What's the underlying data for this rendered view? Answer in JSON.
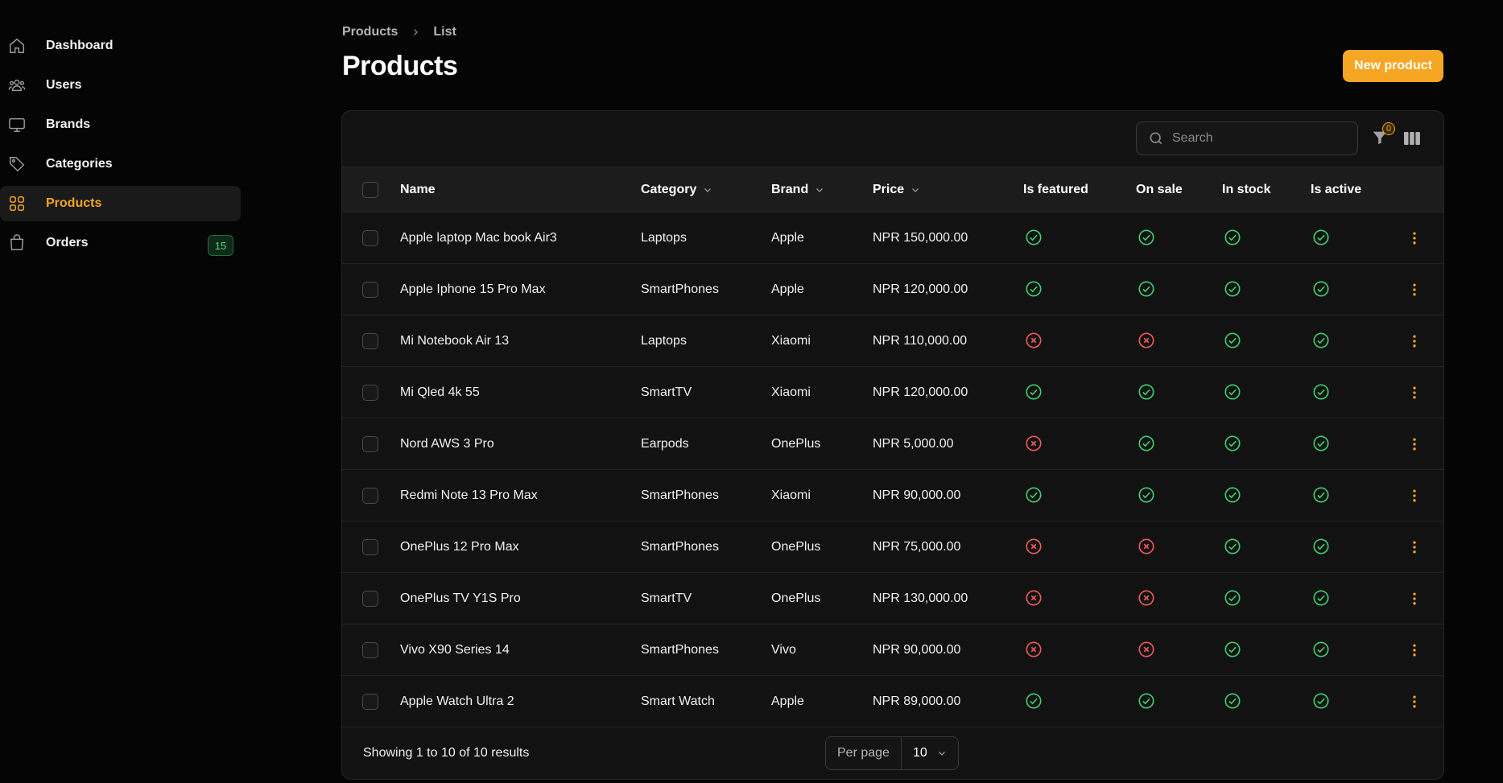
{
  "sidebar": {
    "items": [
      {
        "label": "Dashboard",
        "icon": "home-icon"
      },
      {
        "label": "Users",
        "icon": "users-icon"
      },
      {
        "label": "Brands",
        "icon": "monitor-icon"
      },
      {
        "label": "Categories",
        "icon": "tag-icon"
      },
      {
        "label": "Products",
        "icon": "grid-icon",
        "active": true
      },
      {
        "label": "Orders",
        "icon": "shopping-bag-icon",
        "badge": "15"
      }
    ]
  },
  "breadcrumb": {
    "parent": "Products",
    "current": "List"
  },
  "page": {
    "title": "Products",
    "new_button": "New product"
  },
  "toolbar": {
    "search_placeholder": "Search",
    "filter_count": "0"
  },
  "table": {
    "headers": {
      "name": "Name",
      "category": "Category",
      "brand": "Brand",
      "price": "Price",
      "is_featured": "Is featured",
      "on_sale": "On sale",
      "in_stock": "In stock",
      "is_active": "Is active"
    },
    "rows": [
      {
        "name": "Apple laptop Mac book Air3",
        "category": "Laptops",
        "brand": "Apple",
        "price": "NPR 150,000.00",
        "is_featured": true,
        "on_sale": true,
        "in_stock": true,
        "is_active": true
      },
      {
        "name": "Apple Iphone 15 Pro Max",
        "category": "SmartPhones",
        "brand": "Apple",
        "price": "NPR 120,000.00",
        "is_featured": true,
        "on_sale": true,
        "in_stock": true,
        "is_active": true
      },
      {
        "name": "Mi Notebook Air 13",
        "category": "Laptops",
        "brand": "Xiaomi",
        "price": "NPR 110,000.00",
        "is_featured": false,
        "on_sale": false,
        "in_stock": true,
        "is_active": true
      },
      {
        "name": "Mi Qled 4k 55",
        "category": "SmartTV",
        "brand": "Xiaomi",
        "price": "NPR 120,000.00",
        "is_featured": true,
        "on_sale": true,
        "in_stock": true,
        "is_active": true
      },
      {
        "name": "Nord AWS 3 Pro",
        "category": "Earpods",
        "brand": "OnePlus",
        "price": "NPR 5,000.00",
        "is_featured": false,
        "on_sale": true,
        "in_stock": true,
        "is_active": true
      },
      {
        "name": "Redmi Note 13 Pro Max",
        "category": "SmartPhones",
        "brand": "Xiaomi",
        "price": "NPR 90,000.00",
        "is_featured": true,
        "on_sale": true,
        "in_stock": true,
        "is_active": true
      },
      {
        "name": "OnePlus 12 Pro Max",
        "category": "SmartPhones",
        "brand": "OnePlus",
        "price": "NPR 75,000.00",
        "is_featured": false,
        "on_sale": false,
        "in_stock": true,
        "is_active": true
      },
      {
        "name": "OnePlus TV Y1S Pro",
        "category": "SmartTV",
        "brand": "OnePlus",
        "price": "NPR 130,000.00",
        "is_featured": false,
        "on_sale": false,
        "in_stock": true,
        "is_active": true
      },
      {
        "name": "Vivo X90 Series 14",
        "category": "SmartPhones",
        "brand": "Vivo",
        "price": "NPR 90,000.00",
        "is_featured": false,
        "on_sale": false,
        "in_stock": true,
        "is_active": true
      },
      {
        "name": "Apple Watch Ultra 2",
        "category": "Smart Watch",
        "brand": "Apple",
        "price": "NPR 89,000.00",
        "is_featured": true,
        "on_sale": true,
        "in_stock": true,
        "is_active": true
      }
    ]
  },
  "footer": {
    "results": "Showing 1 to 10 of 10 results",
    "per_page_label": "Per page",
    "per_page_value": "10"
  },
  "colors": {
    "accent": "#f5a623",
    "success": "#3ecf6e",
    "danger": "#ef5a5a",
    "background": "#050505"
  }
}
